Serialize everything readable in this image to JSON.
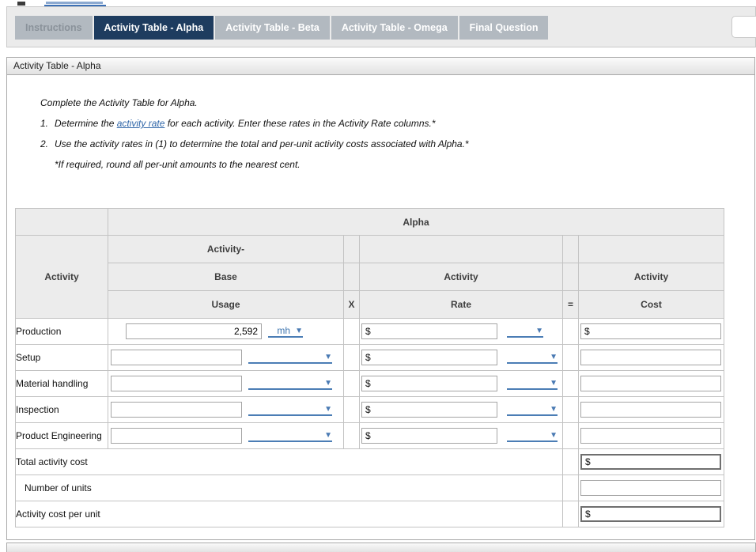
{
  "tabs": {
    "items": [
      {
        "label": "Instructions",
        "state": "disabled"
      },
      {
        "label": "Activity Table - Alpha",
        "state": "active"
      },
      {
        "label": "Activity Table - Beta",
        "state": "default"
      },
      {
        "label": "Activity Table - Omega",
        "state": "default"
      },
      {
        "label": "Final Question",
        "state": "default"
      }
    ]
  },
  "panel": {
    "title": "Activity Table - Alpha"
  },
  "instructions": {
    "intro": "Complete the Activity Table for Alpha.",
    "step1_number": "1.",
    "step1_pre": "Determine the ",
    "step1_link": "activity rate",
    "step1_post": " for each activity. Enter these rates in the Activity Rate columns.*",
    "step2_number": "2.",
    "step2_text": "Use the activity rates in (1) to determine the total and per-unit activity costs associated with Alpha.*",
    "footnote": "*If required, round all per-unit amounts to the nearest cent."
  },
  "table": {
    "currency": "$",
    "group_header": "Alpha",
    "headers": {
      "activity": "Activity",
      "usage_line1": "Activity-",
      "usage_line2": "Base",
      "usage_line3": "Usage",
      "multiply": "X",
      "rate_line1": "Activity",
      "rate_line2": "Rate",
      "equals": "=",
      "cost_line1": "Activity",
      "cost_line2": "Cost"
    },
    "rows": [
      {
        "label": "Production",
        "usage_value": "2,592",
        "usage_unit": "mh",
        "rate_value": "",
        "cost_value": ""
      },
      {
        "label": "Setup",
        "usage_value": "",
        "usage_unit": "",
        "rate_value": "",
        "cost_value": ""
      },
      {
        "label": "Material handling",
        "usage_value": "",
        "usage_unit": "",
        "rate_value": "",
        "cost_value": ""
      },
      {
        "label": "Inspection",
        "usage_value": "",
        "usage_unit": "",
        "rate_value": "",
        "cost_value": ""
      },
      {
        "label": "Product Engineering",
        "usage_value": "",
        "usage_unit": "",
        "rate_value": "",
        "cost_value": ""
      }
    ],
    "totals": [
      {
        "label": "Total activity cost",
        "value": ""
      },
      {
        "label": "Number of units",
        "value": ""
      },
      {
        "label": "Activity cost per unit",
        "value": ""
      }
    ]
  }
}
